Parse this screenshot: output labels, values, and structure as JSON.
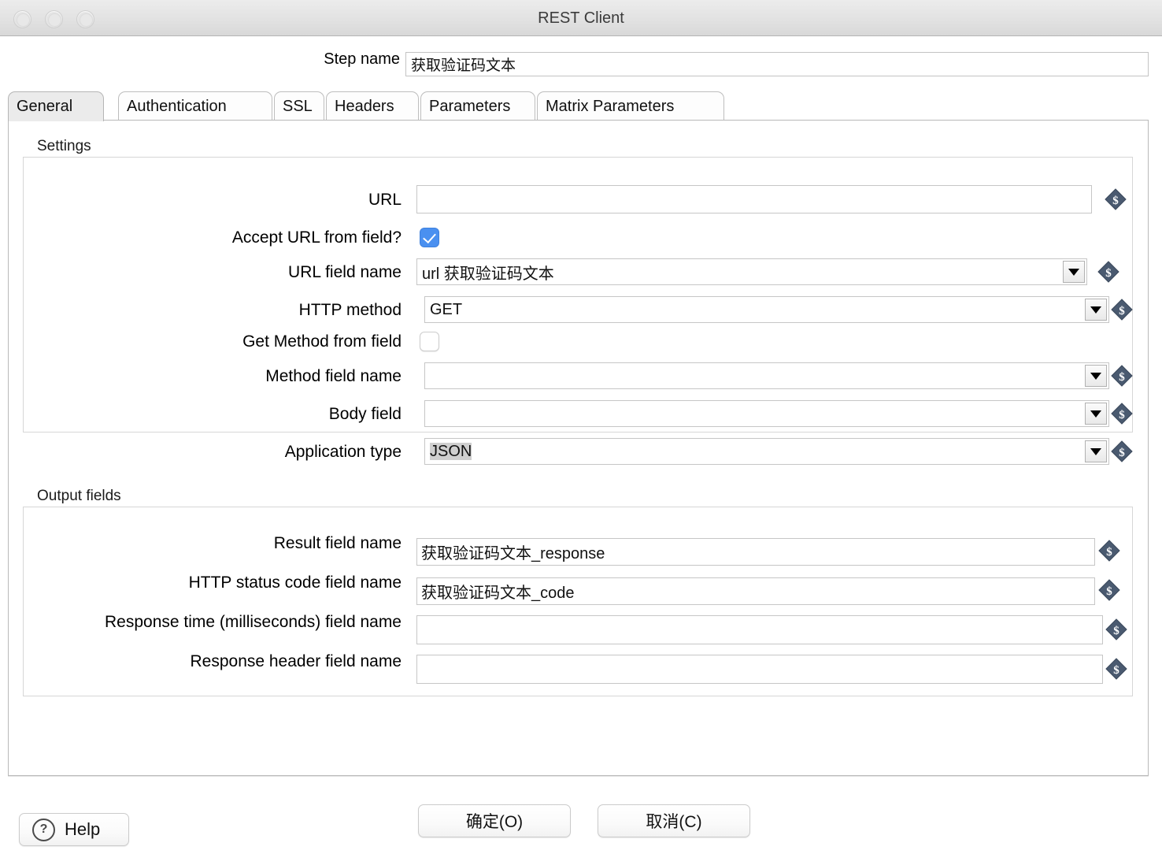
{
  "window": {
    "title": "REST Client",
    "controls": [
      "close-button",
      "minimize-button",
      "zoom-button"
    ]
  },
  "step": {
    "label": "Step name",
    "value": "获取验证码文本",
    "placeholder": ""
  },
  "tabs": [
    {
      "label": "General",
      "active": true
    },
    {
      "label": "Authentication",
      "active": false
    },
    {
      "label": "SSL",
      "active": false
    },
    {
      "label": "Headers",
      "active": false
    },
    {
      "label": "Parameters",
      "active": false
    },
    {
      "label": "Matrix Parameters",
      "active": false
    }
  ],
  "settings": {
    "group_label": "Settings",
    "url": {
      "label": "URL",
      "value": "",
      "placeholder": ""
    },
    "accept_url_from_field": {
      "label": "Accept URL from field?",
      "checked": true
    },
    "url_field_name": {
      "label": "URL field name",
      "value": "url 获取验证码文本"
    },
    "http_method": {
      "label": "HTTP method",
      "value": "GET"
    },
    "get_method_from_field": {
      "label": "Get Method from field",
      "checked": false
    },
    "method_field_name": {
      "label": "Method field name",
      "value": ""
    },
    "body_field": {
      "label": "Body field",
      "value": ""
    },
    "application_type": {
      "label": "Application type",
      "value": "JSON",
      "selected": true
    }
  },
  "output_fields": {
    "group_label": "Output fields",
    "result_field_name": {
      "label": "Result field name",
      "value": "获取验证码文本_response"
    },
    "http_status_code_field_name": {
      "label": "HTTP status code field name",
      "value": "获取验证码文本_code"
    },
    "response_time_field_name": {
      "label": "Response time (milliseconds) field name",
      "value": ""
    },
    "response_header_field_name": {
      "label": "Response header field name",
      "value": ""
    }
  },
  "icons": {
    "variable": "dollar-diamond-icon",
    "dropdown": "chevron-down-icon",
    "help": "question-mark-icon"
  },
  "footer": {
    "help": "Help",
    "ok": "确定(O)",
    "cancel": "取消(C)"
  },
  "colors": {
    "checkbox_on": "#4a90f0",
    "selection": "#cfcfcf",
    "dollar_icon": "#4a5a70",
    "titlebar": "#e5e5e5"
  }
}
